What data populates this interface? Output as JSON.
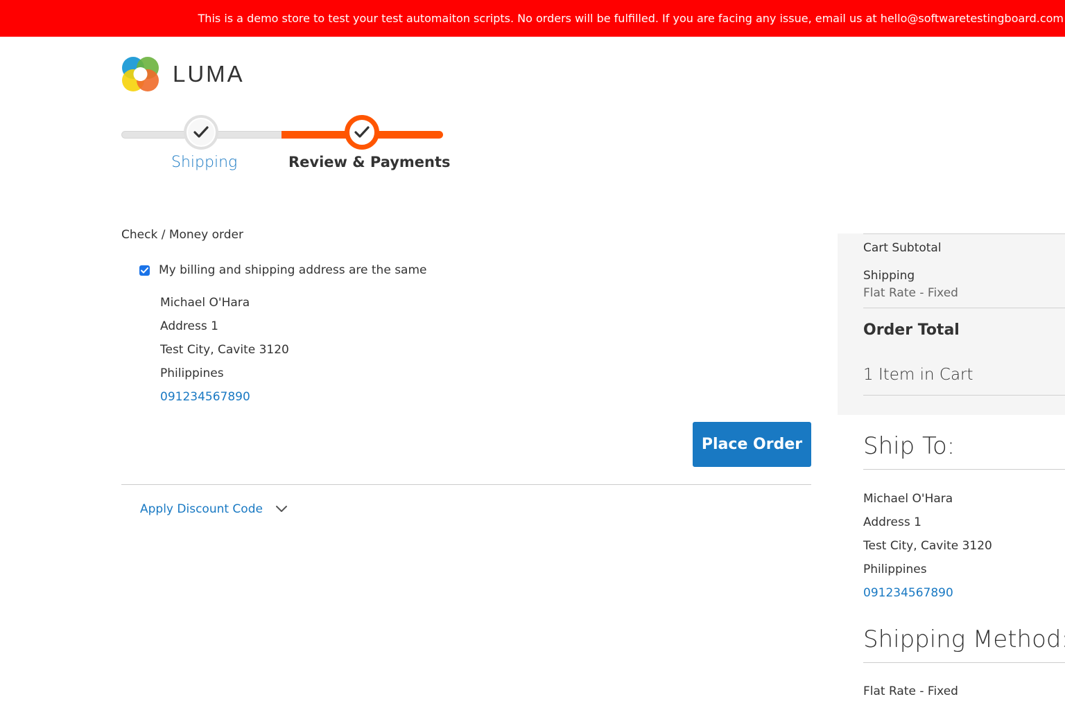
{
  "banner": {
    "text": "This is a demo store to test your test automaiton scripts. No orders will be fulfilled. If you are facing any issue, email us at hello@softwaretestingboard.com"
  },
  "logo": {
    "text": "LUMA"
  },
  "progress": {
    "steps": [
      {
        "label": "Shipping",
        "state": "complete"
      },
      {
        "label": "Review & Payments",
        "state": "active"
      }
    ]
  },
  "payment": {
    "method_title": "Check / Money order",
    "billing_same_label": "My billing and shipping address are the same",
    "billing_same_checked": true,
    "address": {
      "name": "Michael O'Hara",
      "street": "Address 1",
      "city_line": "Test City, Cavite 3120",
      "country": "Philippines",
      "phone": "091234567890"
    },
    "place_order_label": "Place Order"
  },
  "discount": {
    "label": "Apply Discount Code"
  },
  "summary": {
    "cart_subtotal_label": "Cart Subtotal",
    "shipping_label": "Shipping",
    "shipping_method": "Flat Rate - Fixed",
    "order_total_label": "Order Total",
    "items_in_cart": "1 Item in Cart"
  },
  "ship_to": {
    "title": "Ship To:",
    "name": "Michael O'Hara",
    "street": "Address 1",
    "city_line": "Test City, Cavite 3120",
    "country": "Philippines",
    "phone": "091234567890"
  },
  "shipping_method": {
    "title": "Shipping Method:",
    "value": "Flat Rate - Fixed"
  },
  "colors": {
    "banner": "#ff0000",
    "progress_active": "#ff5501",
    "link": "#1979c3",
    "button": "#1979c3",
    "summary_bg": "#f5f5f5"
  }
}
